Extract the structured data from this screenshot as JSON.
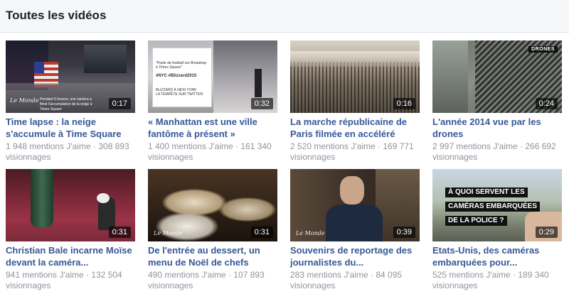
{
  "header": {
    "title": "Toutes les vidéos"
  },
  "videos": [
    {
      "title": "Time lapse : la neige s'accumule à Time Square",
      "meta": "1 948 mentions J'aime · 308 893 visionnages",
      "duration": "0:17",
      "thumb_logo": "Le Monde",
      "thumb_caption": "Pendant 5 heures, une caméra a filmé l'accumulation de la neige à Times Square"
    },
    {
      "title": "« Manhattan est une ville fantôme à présent »",
      "meta": "1 400 mentions J'aime · 161 340 visionnages",
      "duration": "0:32",
      "thumb_card_lines": [
        "\"Partie de football sur Broadway à Times Square\"",
        "#NYC #Blizzard2015",
        "BLIZZARD À NEW YORK",
        "LA TEMPÊTE SUR TWITTER"
      ]
    },
    {
      "title": "La marche républicaine de Paris filmée en accéléré",
      "meta": "2 520 mentions J'aime · 169 771 visionnages",
      "duration": "0:16"
    },
    {
      "title": "L'année 2014 vue par les drones",
      "meta": "2 997 mentions J'aime · 266 692 visionnages",
      "duration": "0:24",
      "thumb_tag": "DRONES"
    },
    {
      "title": "Christian Bale incarne Moïse devant la caméra...",
      "meta": "941 mentions J'aime · 132 504 visionnages",
      "duration": "0:31"
    },
    {
      "title": "De l'entrée au dessert, un menu de Noël de chefs",
      "meta": "490 mentions J'aime · 107 893 visionnages",
      "duration": "0:31",
      "thumb_logo": "Le Monde"
    },
    {
      "title": "Souvenirs de reportage des journalistes du...",
      "meta": "283 mentions J'aime · 84 095 visionnages",
      "duration": "0:39",
      "thumb_logo": "Le Monde"
    },
    {
      "title": "Etats-Unis, des caméras embarquées pour...",
      "meta": "525 mentions J'aime · 189 340 visionnages",
      "duration": "0:29",
      "thumb_banner": [
        "À QUOI SERVENT LES",
        "CAMÉRAS EMBARQUÉES",
        "DE LA POLICE ?"
      ]
    }
  ]
}
